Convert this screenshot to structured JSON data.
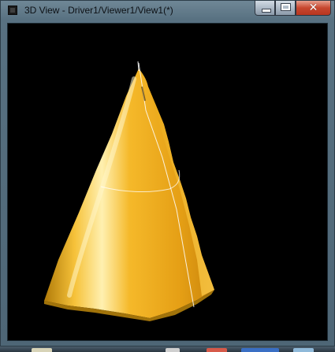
{
  "window": {
    "title": "3D View - Driver1/Viewer1/View1(*)",
    "icon": "app-window-icon",
    "buttons": {
      "minimize": "minimize-icon",
      "maximize": "maximize-icon",
      "close": "✕"
    }
  },
  "viewport": {
    "background_color": "#000000",
    "object": "yellow cone",
    "object_color": "#f2b52a"
  },
  "taskbar": {
    "items": [
      "taskbar-item-1",
      "taskbar-item-2",
      "taskbar-item-3",
      "taskbar-item-4",
      "taskbar-item-5"
    ]
  }
}
